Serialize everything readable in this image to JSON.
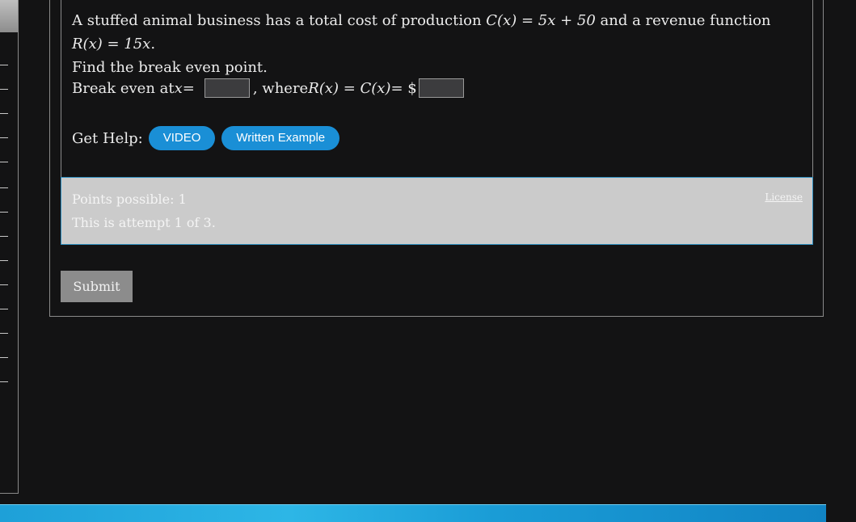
{
  "question": {
    "sentence_start": "A stuffed animal business has a total cost of production ",
    "cost_fn": "C(x) = 5x + 50",
    "sentence_mid": " and a revenue function ",
    "revenue_fn": "R(x) = 15x",
    "sentence_end": ".",
    "prompt": "Find the break even point."
  },
  "answer_line": {
    "label_start": "Break even at ",
    "var": "x",
    "eq": " =",
    "where": ", where ",
    "rc": "R(x) = C(x)",
    "dollar": " = $",
    "x_value": "",
    "dollar_value": ""
  },
  "help": {
    "label": "Get Help:",
    "video_label": "VIDEO",
    "example_label": "Written Example"
  },
  "info": {
    "points": "Points possible: 1",
    "attempt": "This is attempt 1 of 3.",
    "license": "License"
  },
  "submit_label": "Submit",
  "colors": {
    "background": "#131314",
    "pill": "#1a8fd6",
    "info_bg": "#cbcbcb",
    "banner": "#1ea0d8"
  }
}
